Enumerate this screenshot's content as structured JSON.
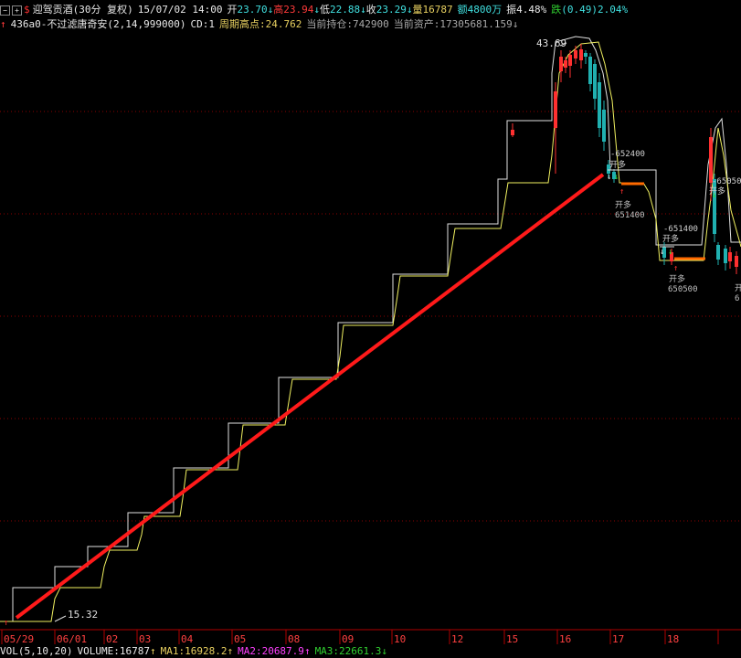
{
  "header": {
    "btn_minus": "−",
    "btn_plus": "+",
    "dollar": "$",
    "name": "迎驾贡酒",
    "period": "(30分 复权)",
    "datetime": "15/07/02 14:00",
    "open_label": "开",
    "open_value": "23.70",
    "high_label": "高",
    "high_value": "23.94",
    "low_label": "低",
    "low_value": "22.88",
    "close_label": "收",
    "close_value": "23.29",
    "vol_label": "量",
    "vol_value": "16787",
    "amount_label": "额",
    "amount_value": "4800万",
    "amp_label": "振",
    "amp_value": "4.48%",
    "fall_label": "跌",
    "fall_value": "(0.49)2.04%",
    "down_arrow": "↓"
  },
  "indicator": {
    "up_arrow": "↑",
    "name": "436a0-不过滤唐奇安(2,14,999000)",
    "cd": "CD:1",
    "cycle_high_label": "周期高点:",
    "cycle_high_value": "24.762",
    "position": "当前持仓:742900",
    "assets": "当前资产:17305681.159",
    "down_arrow": "↓"
  },
  "volume": {
    "label": "VOL(5,10,20)",
    "volume": "VOLUME:16787",
    "ma1": "MA1:16928.2",
    "ma2": "MA2:20687.9",
    "ma3": "MA3:22661.3",
    "up_arrow": "↑",
    "down_arrow": "↓"
  },
  "chart_data": {
    "type": "line",
    "x_ticks": [
      "05/29",
      "06/01",
      "02",
      "03",
      "04",
      "05",
      "08",
      "09",
      "10",
      "12",
      "15",
      "16",
      "17",
      "18"
    ],
    "price_labels": {
      "max": "43.69",
      "min": "15.32"
    },
    "series": [
      {
        "role": "channel-upper",
        "color": "#e0e0e0"
      },
      {
        "role": "channel-lower",
        "color": "#f0f060"
      },
      {
        "role": "trend-line",
        "color": "#ff1a1a"
      }
    ],
    "signals": [
      {
        "text": "开多",
        "value": "651400",
        "type": "buy"
      },
      {
        "text": "开多",
        "value": "650500",
        "type": "buy"
      },
      {
        "text": "开多",
        "value": "6",
        "type": "buy"
      },
      {
        "value": "652400",
        "type": "marker"
      },
      {
        "value": "651400",
        "type": "marker"
      },
      {
        "value": "650500",
        "type": "marker"
      }
    ],
    "markers": {
      "open_long": "开多",
      "down": "↓",
      "up": "↑"
    },
    "colors": {
      "background": "#000000",
      "grid": "#8b0000",
      "axis": "#b00000",
      "candle_up": "#ff3030",
      "candle_down": "#20b0b0"
    }
  }
}
